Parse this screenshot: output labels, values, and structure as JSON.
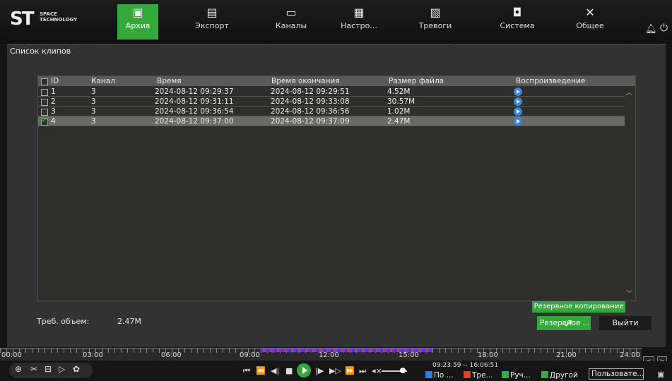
{
  "logo": {
    "mark": "ST",
    "subtitle": "SPACE TECHNOLOGY"
  },
  "nav": [
    {
      "label": "Архив",
      "icon": "archive-icon",
      "active": true
    },
    {
      "label": "Экспорт",
      "icon": "save-icon"
    },
    {
      "label": "Каналы",
      "icon": "camera-icon"
    },
    {
      "label": "Настро...",
      "icon": "settings-icon"
    },
    {
      "label": "Тревоги",
      "icon": "alarm-icon"
    },
    {
      "label": "Система",
      "icon": "system-icon"
    },
    {
      "label": "Общее",
      "icon": "tools-icon"
    }
  ],
  "panel": {
    "title": "Список клипов"
  },
  "table": {
    "columns": [
      "ID",
      "Канал",
      "Время",
      "Время окончания",
      "Размер файла",
      "Воспроизведение"
    ],
    "rows": [
      {
        "id": "1",
        "channel": "3",
        "start": "2024-08-12 09:29:37",
        "end": "2024-08-12 09:29:51",
        "size": "4.52M",
        "checked": false
      },
      {
        "id": "2",
        "channel": "3",
        "start": "2024-08-12 09:31:11",
        "end": "2024-08-12 09:33:08",
        "size": "30.57M",
        "checked": false
      },
      {
        "id": "3",
        "channel": "3",
        "start": "2024-08-12 09:36:54",
        "end": "2024-08-12 09:36:56",
        "size": "1.02M",
        "checked": false
      },
      {
        "id": "4",
        "channel": "3",
        "start": "2024-08-12 09:37:00",
        "end": "2024-08-12 09:37:09",
        "size": "2.47M",
        "checked": true
      }
    ]
  },
  "required": {
    "label": "Треб. объем:",
    "value": "2.47M"
  },
  "tooltip": "Резервное копирование",
  "buttons": {
    "backup": "Резервное ...",
    "exit": "Выйти"
  },
  "timeline": {
    "ticks": [
      "00:00",
      "03:00",
      "06:00",
      "09:00",
      "12:00",
      "15:00",
      "18:00",
      "21:00",
      "24:00"
    ]
  },
  "time_range": "09:23:59 -- 16:06:51",
  "filters": [
    {
      "label": "По ...",
      "color": "#2f7fd8"
    },
    {
      "label": "Тре...",
      "color": "#d8452f"
    },
    {
      "label": "Руч...",
      "color": "#3aa84a"
    },
    {
      "label": "Другой",
      "color": "#3aa84a"
    }
  ],
  "user_select": "Пользовате...",
  "colors": {
    "accent": "#35a83c",
    "background": "#323232"
  }
}
